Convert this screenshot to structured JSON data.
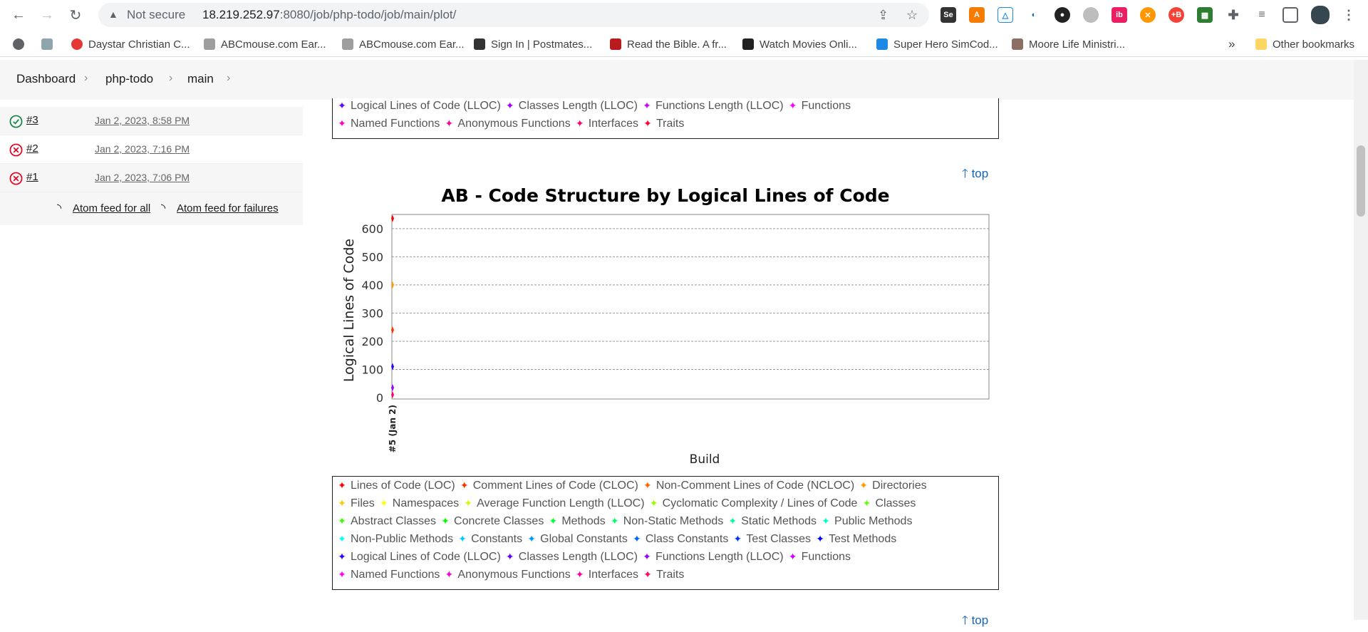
{
  "browser": {
    "security_label": "Not secure",
    "url_host": "18.219.252.97",
    "url_rest": ":8080/job/php-todo/job/main/plot/",
    "bookmarks": [
      {
        "label": "Daystar Christian C...",
        "color": "#e53935"
      },
      {
        "label": "ABCmouse.com Ear...",
        "color": "#9e9e9e"
      },
      {
        "label": "ABCmouse.com Ear...",
        "color": "#9e9e9e"
      },
      {
        "label": "Sign In | Postmates...",
        "color": "#333333"
      },
      {
        "label": "Read the Bible. A fr...",
        "color": "#b71c1c"
      },
      {
        "label": "Watch Movies Onli...",
        "color": "#212121"
      },
      {
        "label": "Super Hero SimCod...",
        "color": "#1e88e5"
      },
      {
        "label": "Moore Life Ministri...",
        "color": "#8d6e63"
      }
    ],
    "more_label": "»",
    "other_bookmarks": "Other bookmarks"
  },
  "breadcrumb": {
    "items": [
      "Dashboard",
      "php-todo",
      "main"
    ]
  },
  "history": {
    "rows": [
      {
        "num": "#3",
        "date": "Jan 2, 2023, 8:58 PM",
        "status": "success"
      },
      {
        "num": "#2",
        "date": "Jan 2, 2023, 7:16 PM",
        "status": "failed"
      },
      {
        "num": "#1",
        "date": "Jan 2, 2023, 7:06 PM",
        "status": "failed"
      }
    ],
    "feed_all": "Atom feed for all",
    "feed_failures": "Atom feed for failures"
  },
  "top_link": "top",
  "legend": {
    "top_lines": [
      [
        "Logical Lines of Code (LLOC)",
        "Classes Length (LLOC)",
        "Functions Length (LLOC)",
        "Functions"
      ],
      [
        "Named Functions",
        "Anonymous Functions",
        "Interfaces",
        "Traits"
      ]
    ],
    "lines": [
      [
        "Lines of Code (LOC)",
        "Comment Lines of Code (CLOC)",
        "Non-Comment Lines of Code (NCLOC)",
        "Directories"
      ],
      [
        "Files",
        "Namespaces",
        "Average Function Length (LLOC)",
        "Cyclomatic Complexity / Lines of Code",
        "Classes"
      ],
      [
        "Abstract Classes",
        "Concrete Classes",
        "Methods",
        "Non-Static Methods",
        "Static Methods",
        "Public Methods"
      ],
      [
        "Non-Public Methods",
        "Constants",
        "Global Constants",
        "Class Constants",
        "Test Classes",
        "Test Methods"
      ],
      [
        "Logical Lines of Code (LLOC)",
        "Classes Length (LLOC)",
        "Functions Length (LLOC)",
        "Functions"
      ],
      [
        "Named Functions",
        "Anonymous Functions",
        "Interfaces",
        "Traits"
      ]
    ],
    "marker_colors": [
      "#ff0000",
      "#ff3300",
      "#ff6600",
      "#ff9900",
      "#ffcc00",
      "#ffff00",
      "#ccff00",
      "#99ff00",
      "#66ff00",
      "#33ff00",
      "#00ff00",
      "#00ff33",
      "#00ff66",
      "#00ff99",
      "#00ffcc",
      "#00ffff",
      "#00ccff",
      "#0099ff",
      "#0066ff",
      "#0033ff",
      "#0000ff",
      "#3300ff",
      "#6600ff",
      "#9900ff",
      "#cc00ff",
      "#ff00ff",
      "#ff00cc",
      "#ff0099",
      "#ff0066",
      "#ff0033"
    ]
  },
  "chart_data": {
    "type": "line",
    "title": "AB - Code Structure by Logical Lines of Code",
    "xlabel": "Build",
    "ylabel": "Logical Lines of Code",
    "categories": [
      "#5 (Jan 2)"
    ],
    "ylim": [
      0,
      630
    ],
    "yticks": [
      0,
      100,
      200,
      300,
      400,
      500,
      600
    ],
    "grid": true,
    "points": [
      {
        "value": 636,
        "color": "#ff0000"
      },
      {
        "value": 400,
        "color": "#ff9900"
      },
      {
        "value": 240,
        "color": "#ff3300"
      },
      {
        "value": 110,
        "color": "#3300ff"
      },
      {
        "value": 35,
        "color": "#9900ff"
      },
      {
        "value": 10,
        "color": "#ff0066"
      }
    ]
  }
}
